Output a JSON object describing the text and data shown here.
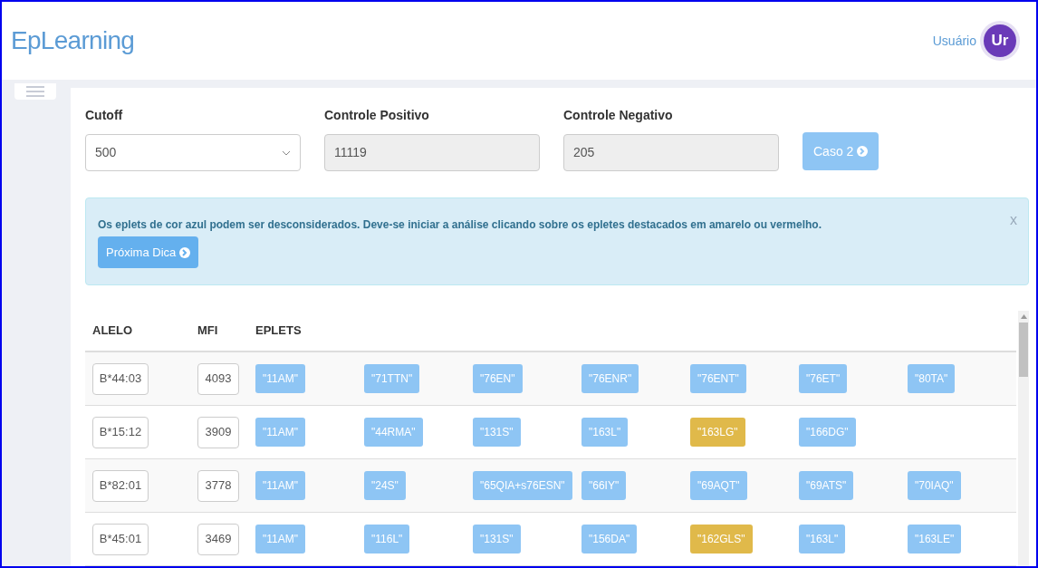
{
  "header": {
    "logo": "EpLearning",
    "user_label": "Usuário",
    "avatar": "Ur"
  },
  "form": {
    "cutoff": {
      "label": "Cutoff",
      "value": "500"
    },
    "positive": {
      "label": "Controle Positivo",
      "value": "11119"
    },
    "negative": {
      "label": "Controle Negativo",
      "value": "205"
    },
    "next_case": "Caso 2"
  },
  "alert": {
    "text": "Os eplets de cor azul podem ser desconsiderados. Deve-se iniciar a análise clicando sobre os epletes destacados em amarelo ou vermelho.",
    "button": "Próxima Dica",
    "close": "x"
  },
  "table": {
    "columns": [
      "ALELO",
      "MFI",
      "EPLETS"
    ],
    "rows": [
      {
        "allele": "B*44:03",
        "mfi": "4093",
        "eplets": [
          {
            "label": "\"11AM\"",
            "color": "#8ec5f4"
          },
          {
            "label": "\"71TTN\"",
            "color": "#8ec5f4"
          },
          {
            "label": "\"76EN\"",
            "color": "#8ec5f4"
          },
          {
            "label": "\"76ENR\"",
            "color": "#8ec5f4"
          },
          {
            "label": "\"76ENT\"",
            "color": "#8ec5f4"
          },
          {
            "label": "\"76ET\"",
            "color": "#8ec5f4"
          },
          {
            "label": "\"80TA\"",
            "color": "#8ec5f4"
          }
        ]
      },
      {
        "allele": "B*15:12",
        "mfi": "3909",
        "eplets": [
          {
            "label": "\"11AM\"",
            "color": "#8ec5f4"
          },
          {
            "label": "\"44RMA\"",
            "color": "#8ec5f4"
          },
          {
            "label": "\"131S\"",
            "color": "#8ec5f4"
          },
          {
            "label": "\"163L\"",
            "color": "#8ec5f4"
          },
          {
            "label": "\"163LG\"",
            "color": "#e0b94a"
          },
          {
            "label": "\"166DG\"",
            "color": "#8ec5f4"
          }
        ]
      },
      {
        "allele": "B*82:01",
        "mfi": "3778",
        "eplets": [
          {
            "label": "\"11AM\"",
            "color": "#8ec5f4"
          },
          {
            "label": "\"24S\"",
            "color": "#8ec5f4"
          },
          {
            "label": "\"65QIA+s76ESN\"",
            "color": "#8ec5f4"
          },
          {
            "label": "\"66IY\"",
            "color": "#8ec5f4"
          },
          {
            "label": "\"69AQT\"",
            "color": "#8ec5f4"
          },
          {
            "label": "\"69ATS\"",
            "color": "#8ec5f4"
          },
          {
            "label": "\"70IAQ\"",
            "color": "#8ec5f4"
          }
        ]
      },
      {
        "allele": "B*45:01",
        "mfi": "3469",
        "eplets": [
          {
            "label": "\"11AM\"",
            "color": "#8ec5f4"
          },
          {
            "label": "\"116L\"",
            "color": "#8ec5f4"
          },
          {
            "label": "\"131S\"",
            "color": "#8ec5f4"
          },
          {
            "label": "\"156DA\"",
            "color": "#8ec5f4"
          },
          {
            "label": "\"162GLS\"",
            "color": "#e0b94a"
          },
          {
            "label": "\"163L\"",
            "color": "#8ec5f4"
          },
          {
            "label": "\"163LE\"",
            "color": "#8ec5f4"
          }
        ]
      }
    ]
  }
}
